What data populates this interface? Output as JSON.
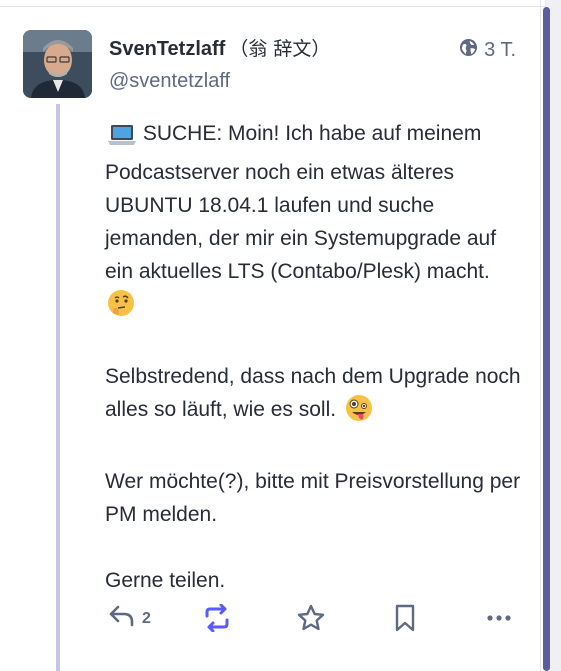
{
  "post": {
    "display_name": "SvenTetzlaff",
    "display_name_cjk": "（翁 辞文）",
    "handle": "@sventetzlaff",
    "visibility_icon": "globe-icon",
    "time": "3 T.",
    "paragraphs": [
      "SUCHE: Moin! Ich habe auf meinem Podcastserver noch ein etwas älteres UBUNTU 18.04.1 laufen und suche jemanden, der mir ein Systemupgrade auf ein aktuelles LTS (Contabo/Plesk) macht.",
      "Selbstredend, dass nach dem Upgrade noch alles so läuft, wie es soll.",
      "Wer möchte(?), bitte mit Preisvorstellung per PM melden.",
      "Gerne teilen."
    ]
  },
  "actions": {
    "reply_count": "2",
    "reply_icon": "reply-icon",
    "boost_icon": "boost-icon",
    "favourite_icon": "star-icon",
    "bookmark_icon": "bookmark-icon",
    "more_icon": "more-icon"
  },
  "colors": {
    "text": "#282c37",
    "muted": "#606984",
    "accent": "#595aff",
    "thread_line": "#c7c6e2",
    "scrollbar_thumb": "#5b5d9c"
  }
}
